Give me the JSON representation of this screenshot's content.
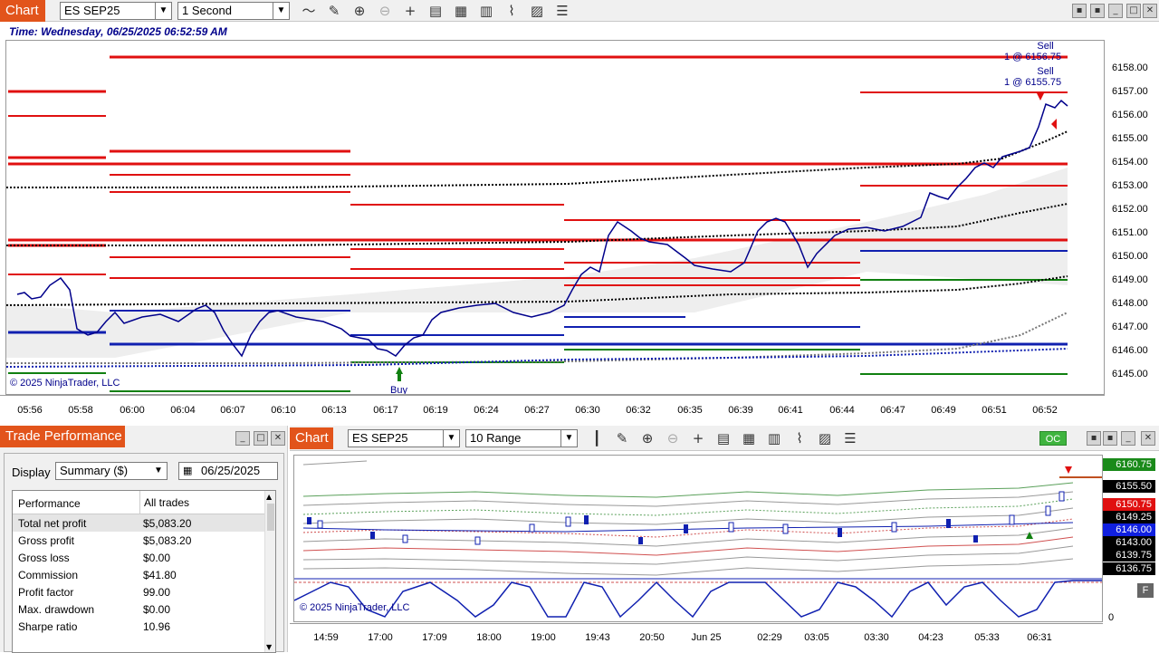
{
  "top_window": {
    "tab_label": "Chart",
    "instrument": "ES SEP25",
    "interval": "1 Second",
    "time_label": "Time: Wednesday, 06/25/2025 06:52:59 AM",
    "price_ticks": [
      "6158.00",
      "6157.00",
      "6156.00",
      "6155.00",
      "6154.00",
      "6153.00",
      "6152.00",
      "6151.00",
      "6150.00",
      "6149.00",
      "6148.00",
      "6147.00",
      "6146.00",
      "6145.00"
    ],
    "time_ticks": [
      "05:56",
      "05:58",
      "06:00",
      "06:04",
      "06:07",
      "06:10",
      "06:13",
      "06:17",
      "06:19",
      "06:24",
      "06:27",
      "06:30",
      "06:32",
      "06:35",
      "06:39",
      "06:41",
      "06:44",
      "06:47",
      "06:49",
      "06:51",
      "06:52"
    ],
    "copyright": "© 2025 NinjaTrader, LLC",
    "annotations": {
      "sell1_label": "Sell",
      "sell1_detail": "1 @ 6156.75",
      "sell2_label": "Sell",
      "sell2_detail": "1 @ 6155.75",
      "buy_label": "Buy"
    }
  },
  "trade_performance": {
    "tab_label": "Trade Performance",
    "display_label": "Display",
    "display_value": "Summary ($)",
    "date_value": "06/25/2025",
    "col_performance": "Performance",
    "col_all_trades": "All trades",
    "rows": [
      {
        "label": "Total net profit",
        "value": "$5,083.20"
      },
      {
        "label": "Gross profit",
        "value": "$5,083.20"
      },
      {
        "label": "Gross loss",
        "value": "$0.00"
      },
      {
        "label": "Commission",
        "value": "$41.80"
      },
      {
        "label": "Profit factor",
        "value": "99.00"
      },
      {
        "label": "Max. drawdown",
        "value": "$0.00"
      },
      {
        "label": "Sharpe ratio",
        "value": "10.96"
      }
    ]
  },
  "bottom_window": {
    "tab_label": "Chart",
    "instrument": "ES SEP25",
    "interval": "10 Range",
    "oc_label": "OC",
    "copyright": "© 2025 NinjaTrader, LLC",
    "price_badges": [
      {
        "text": "6160.75",
        "color": "#1a8a1a"
      },
      {
        "text": "6155.50",
        "color": "#000000"
      },
      {
        "text": "6150.75",
        "color": "#e01010"
      },
      {
        "text": "6149.25",
        "color": "#000000"
      },
      {
        "text": "6146.00",
        "color": "#1020e0"
      },
      {
        "text": "6143.00",
        "color": "#000000"
      },
      {
        "text": "6139.75",
        "color": "#000000"
      },
      {
        "text": "6136.75",
        "color": "#000000"
      }
    ],
    "osc_ticks": [
      "0"
    ],
    "f_label": "F",
    "time_ticks": [
      "14:59",
      "17:00",
      "17:09",
      "18:00",
      "19:00",
      "19:43",
      "20:50",
      "Jun 25",
      "02:29",
      "03:05",
      "03:30",
      "04:23",
      "05:33",
      "06:31"
    ]
  },
  "colors": {
    "accent": "#e2541b",
    "price_line": "#00008b",
    "resistance": "#e01010",
    "support": "#108010",
    "pivot": "#1020b0"
  }
}
